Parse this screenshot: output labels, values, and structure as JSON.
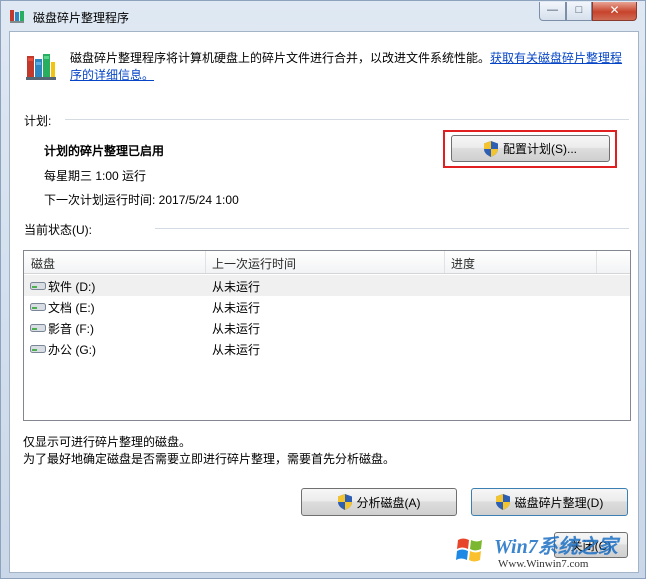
{
  "window": {
    "title": "磁盘碎片整理程序",
    "minimize_glyph": "—",
    "maximize_glyph": "□",
    "close_glyph": "✕"
  },
  "intro": {
    "text": "磁盘碎片整理程序将计算机硬盘上的碎片文件进行合并，以改进文件系统性能。",
    "link": "获取有关磁盘碎片整理程序的详细信息。"
  },
  "schedule": {
    "label": "计划:",
    "status": "计划的碎片整理已启用",
    "frequency": "每星期三  1:00 运行",
    "next_run": "下一次计划运行时间: 2017/5/24 1:00",
    "configure_button": "配置计划(S)..."
  },
  "current_status": {
    "label": "当前状态(U):",
    "columns": [
      "磁盘",
      "上一次运行时间",
      "进度"
    ],
    "rows": [
      {
        "disk": "软件 (D:)",
        "last_run": "从未运行",
        "progress": ""
      },
      {
        "disk": "文档 (E:)",
        "last_run": "从未运行",
        "progress": ""
      },
      {
        "disk": "影音 (F:)",
        "last_run": "从未运行",
        "progress": ""
      },
      {
        "disk": "办公 (G:)",
        "last_run": "从未运行",
        "progress": ""
      }
    ]
  },
  "notes": {
    "line1": "仅显示可进行碎片整理的磁盘。",
    "line2": "为了最好地确定磁盘是否需要立即进行碎片整理，需要首先分析磁盘。"
  },
  "buttons": {
    "analyze": "分析磁盘(A)",
    "defrag": "磁盘碎片整理(D)",
    "close": "关闭(C)"
  },
  "watermark": {
    "brand": "Win7系统之家",
    "url": "Www.Winwin7.com"
  },
  "icons": {
    "title": "defrag-app-icon",
    "shield": "uac-shield-icon",
    "drive": "hard-drive-icon"
  }
}
